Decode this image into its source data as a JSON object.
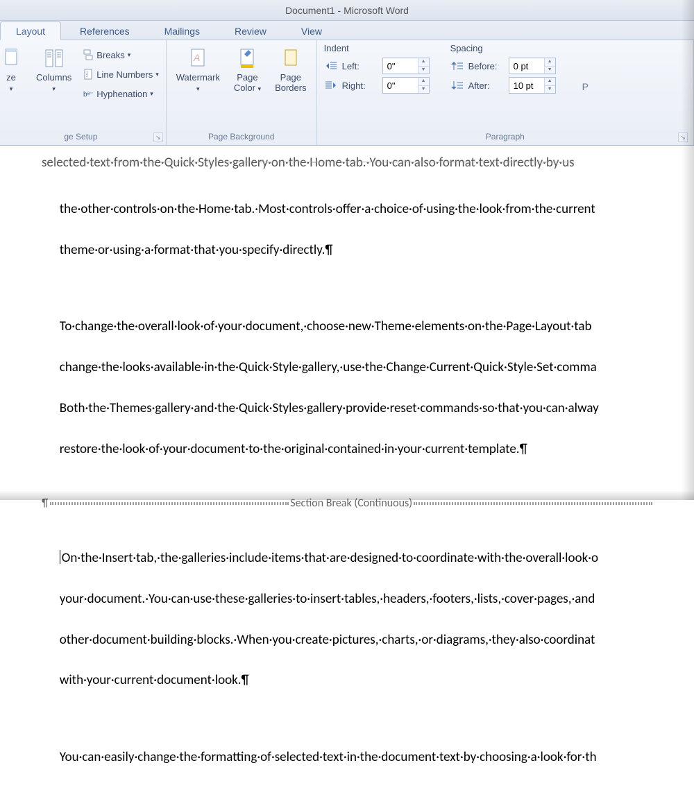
{
  "title": "Document1  -  Microsoft Word",
  "tabs": {
    "layout": "Layout",
    "references": "References",
    "mailings": "Mailings",
    "review": "Review",
    "view": "View"
  },
  "ribbon": {
    "page_setup": {
      "size": "ze",
      "columns": "Columns",
      "breaks": "Breaks",
      "line_numbers": "Line Numbers",
      "hyphenation": "Hyphenation",
      "group_label": "ge Setup"
    },
    "page_background": {
      "watermark": "Watermark",
      "page_color": "Page\nColor",
      "page_borders": "Page\nBorders",
      "group_label": "Page Background"
    },
    "paragraph": {
      "indent_title": "Indent",
      "spacing_title": "Spacing",
      "left_label": "Left:",
      "right_label": "Right:",
      "before_label": "Before:",
      "after_label": "After:",
      "left_value": "0\"",
      "right_value": "0\"",
      "before_value": "0 pt",
      "after_value": "10 pt",
      "group_label": "Paragraph",
      "p_letter": "P"
    }
  },
  "document": {
    "cutoff_top": "selected·text·from·the·Quick·Styles·gallery·on·the·Home·tab.·You·can·also·format·text·directly·by·us",
    "p1_l1": "the·other·controls·on·the·Home·tab.·Most·controls·offer·a·choice·of·using·the·look·from·the·current",
    "p1_l2": "theme·or·using·a·format·that·you·specify·directly.¶",
    "p2_l1": "To·change·the·overall·look·of·your·document,·choose·new·Theme·elements·on·the·Page·Layout·tab",
    "p2_l2": "change·the·looks·available·in·the·Quick·Style·gallery,·use·the·Change·Current·Quick·Style·Set·comma",
    "p2_l3": "Both·the·Themes·gallery·and·the·Quick·Styles·gallery·provide·reset·commands·so·that·you·can·alway",
    "p2_l4": "restore·the·look·of·your·document·to·the·original·contained·in·your·current·template.¶",
    "section_break_pilcrow": "¶",
    "section_break_text": "Section Break (Continuous)",
    "p3_l1": "On·the·Insert·tab,·the·galleries·include·items·that·are·designed·to·coordinate·with·the·overall·look·o",
    "p3_l2": "your·document.·You·can·use·these·galleries·to·insert·tables,·headers,·footers,·lists,·cover·pages,·and",
    "p3_l3": "other·document·building·blocks.·When·you·create·pictures,·charts,·or·diagrams,·they·also·coordinat",
    "p3_l4": "with·your·current·document·look.¶",
    "p4_l1": "You·can·easily·change·the·formatting·of·selected·text·in·the·document·text·by·choosing·a·look·for·th"
  }
}
